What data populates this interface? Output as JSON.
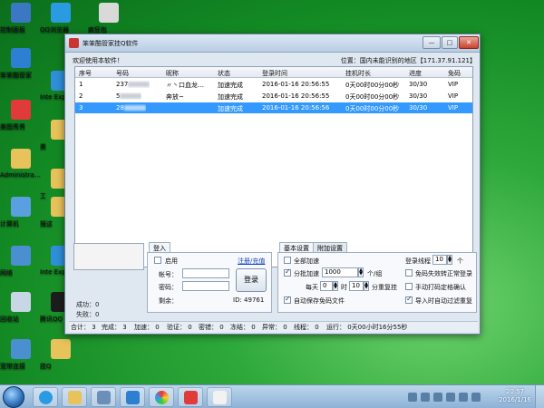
{
  "desktop": {
    "icons": [
      {
        "name": "control-panel",
        "label": "控制面板",
        "color": "#3b78c4"
      },
      {
        "name": "qq-browser",
        "label": "QQ浏览器",
        "color": "#2a9be0"
      },
      {
        "name": "red-packet",
        "label": "疯狂包",
        "color": "#d9d9d9"
      },
      {
        "name": "app-manager",
        "label": "笨笨酷管家",
        "color": "#2d7fd1"
      },
      {
        "name": "ie",
        "label": "Inte Explo",
        "color": "#2f8fd8"
      },
      {
        "name": "meitu",
        "label": "美图秀秀",
        "color": "#e03a3a"
      },
      {
        "name": "folder-1",
        "label": "美",
        "color": "#e8c25a"
      },
      {
        "name": "administrator",
        "label": "Administra…",
        "color": "#e8c25a"
      },
      {
        "name": "folder-2",
        "label": "工",
        "color": "#e8c25a"
      },
      {
        "name": "computer",
        "label": "计算机",
        "color": "#5aa0e0"
      },
      {
        "name": "folder-3",
        "label": "搜这",
        "color": "#e8c25a"
      },
      {
        "name": "network",
        "label": "网络",
        "color": "#4a8fd0"
      },
      {
        "name": "ie-2",
        "label": "Inte Explo",
        "color": "#2f8fd8"
      },
      {
        "name": "recycle-bin",
        "label": "回收站",
        "color": "#c8d6e6"
      },
      {
        "name": "tencent-qq",
        "label": "腾讯QQ",
        "color": "#1d1d1d"
      },
      {
        "name": "broadband",
        "label": "宽带连接",
        "color": "#4a8fd0"
      },
      {
        "name": "hang-qq",
        "label": "挂Q",
        "color": "#e8c25a"
      }
    ]
  },
  "window": {
    "title": "笨笨酷管家挂Q软件",
    "welcome": "欢迎使用本软件！",
    "location": "位置：国内未能识别的地区【171.37.91.121】",
    "minimize": "—",
    "maximize": "□",
    "close": "✕"
  },
  "table": {
    "headers": [
      "序号",
      "号码",
      "昵称",
      "状态",
      "登录时间",
      "挂机时长",
      "进度",
      "免码"
    ],
    "rows": [
      {
        "no": "1",
        "qq": "237",
        "nick": "〃丶口血龙…",
        "status": "加速完成",
        "login": "2016-01-16 20:56:55",
        "duration": "0天00时00分00秒",
        "progress": "30/30",
        "vip": "VIP",
        "selected": false
      },
      {
        "no": "2",
        "qq": "5",
        "nick": "奔放~",
        "status": "加速完成",
        "login": "2016-01-16 20:56:55",
        "duration": "0天00时00分00秒",
        "progress": "30/30",
        "vip": "VIP",
        "selected": false
      },
      {
        "no": "3",
        "qq": "28",
        "nick": "",
        "status": "加速完成",
        "login": "2016-01-16 20:56:56",
        "duration": "0天00时00分00秒",
        "progress": "30/30",
        "vip": "VIP",
        "selected": true
      }
    ]
  },
  "left_panel": {
    "success_label": "成功：0",
    "fail_label": "失败：0"
  },
  "login_panel": {
    "tab": "登入",
    "enable_label": "启用",
    "register_link": "注册/充值",
    "account_label": "帐号：",
    "password_label": "密码：",
    "remaining_label": "剩余：",
    "id_label": "ID: 49761",
    "login_button": "登录"
  },
  "settings_panel": {
    "tab_basic": "基本设置",
    "tab_extra": "附加设置",
    "all_accelerate": "全部加速",
    "login_threads_label": "登录线程",
    "login_threads_value": "10",
    "threads_unit": "个",
    "batch_accelerate": "分批加速",
    "batch_value": "1000",
    "batch_unit": "个/组",
    "auto_free_code": "免码失效转正常登录",
    "daily_label": "每天",
    "daily_hour": "0",
    "hour_unit": "时",
    "daily_minute": "10",
    "minute_unit": "分重复挂",
    "manual_confirm": "手动打码定格确认",
    "auto_save": "自动保存免码文件",
    "auto_filter": "导入时自动过滤重复"
  },
  "status_bar": {
    "total": "合计：  3",
    "done": "完成：  3",
    "accel": "加速：  0",
    "verify": "验证：  0",
    "frozen": "密错：  0",
    "freeze": "冻结：  0",
    "abnormal": "异常：  0",
    "threads": "线程：  0",
    "running": "运行：  0天00小时16分55秒"
  },
  "taskbar": {
    "time": "20:57",
    "date": "2016/1/16"
  }
}
